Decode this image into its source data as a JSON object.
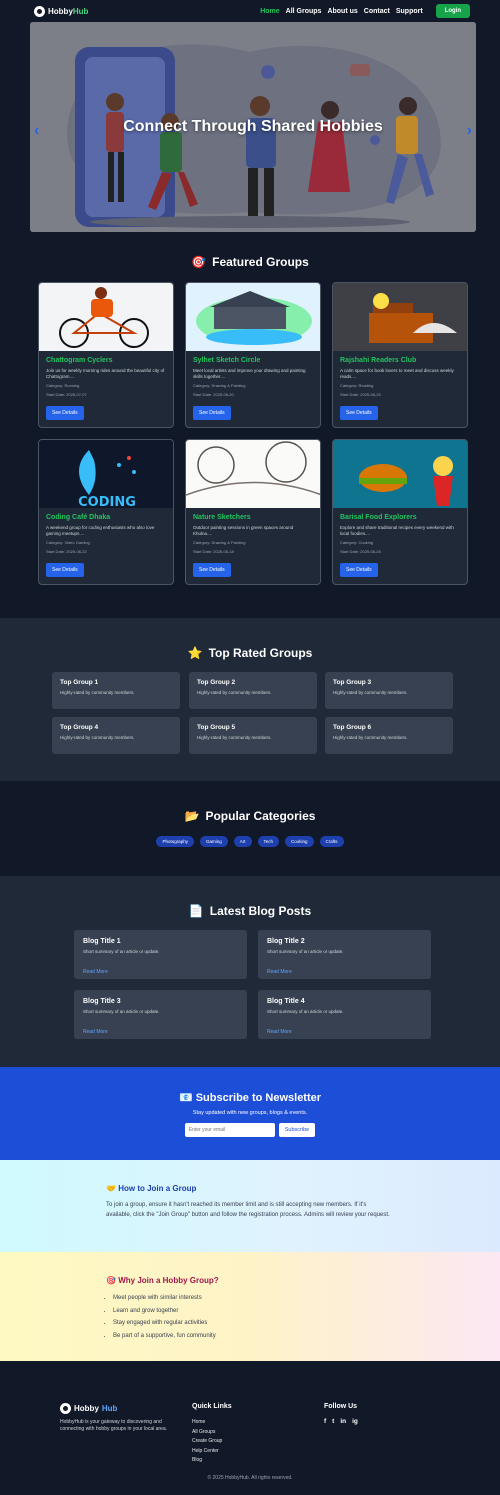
{
  "nav": {
    "brand_a": "Hobby",
    "brand_b": "Hub",
    "links": [
      "Home",
      "All Groups",
      "About us",
      "Contact",
      "Support"
    ],
    "login": "Login"
  },
  "hero": {
    "title": "Connect Through Shared Hobbies",
    "prev": "‹",
    "next": "›"
  },
  "featured": {
    "icon": "🎯",
    "title": "Featured Groups",
    "category_label": "Category:",
    "date_label": "Start Date:",
    "button": "See Details",
    "groups": [
      {
        "name": "Chattogram Cyclers",
        "desc": "Join us for weekly morning rides around the beautiful city of Chattogram....",
        "category": "Running",
        "date": "2025-07-07"
      },
      {
        "name": "Sylhet Sketch Circle",
        "desc": "Meet local artists and improve your drawing and painting skills together....",
        "category": "Drawing & Painting",
        "date": "2025-06-20"
      },
      {
        "name": "Rajshahi Readers Club",
        "desc": "A calm space for book lovers to meet and discuss weekly reads....",
        "category": "Reading",
        "date": "2025-06-25"
      },
      {
        "name": "Coding Café Dhaka",
        "desc": "A weekend group for coding enthusiasts who also love gaming meetups....",
        "category": "Video Gaming",
        "date": "2025-06-22"
      },
      {
        "name": "Nature Sketchers",
        "desc": "Outdoor painting sessions in green spaces around Khulna....",
        "category": "Drawing & Painting",
        "date": "2025-06-18"
      },
      {
        "name": "Barisal Food Explorers",
        "desc": "Explore and share traditional recipes every weekend with local foodies....",
        "category": "Cooking",
        "date": "2025-06-28"
      }
    ]
  },
  "top_rated": {
    "icon": "⭐",
    "title": "Top Rated Groups",
    "items": [
      {
        "name": "Top Group 1",
        "desc": "Highly-rated by community members."
      },
      {
        "name": "Top Group 2",
        "desc": "Highly-rated by community members."
      },
      {
        "name": "Top Group 3",
        "desc": "Highly-rated by community members."
      },
      {
        "name": "Top Group 4",
        "desc": "Highly-rated by community members."
      },
      {
        "name": "Top Group 5",
        "desc": "Highly-rated by community members."
      },
      {
        "name": "Top Group 6",
        "desc": "Highly-rated by community members."
      }
    ]
  },
  "categories": {
    "icon": "📂",
    "title": "Popular Categories",
    "items": [
      "Photography",
      "Gaming",
      "Art",
      "Tech",
      "Cooking",
      "Crafts"
    ]
  },
  "blog": {
    "icon": "📄",
    "title": "Latest Blog Posts",
    "read_more": "Read More",
    "posts": [
      {
        "title": "Blog Title 1",
        "summary": "Short summary of an article or update."
      },
      {
        "title": "Blog Title 2",
        "summary": "Short summary of an article or update."
      },
      {
        "title": "Blog Title 3",
        "summary": "Short summary of an article or update."
      },
      {
        "title": "Blog Title 4",
        "summary": "Short summary of an article or update."
      }
    ]
  },
  "newsletter": {
    "icon": "📧",
    "title": "Subscribe to Newsletter",
    "subtitle": "Stay updated with new groups, blogs & events.",
    "placeholder": "Enter your email",
    "button": "Subscribe"
  },
  "how": {
    "icon": "🤝",
    "title": "How to Join a Group",
    "text": "To join a group, ensure it hasn't reached its member limit and is still accepting new members. If it's available, click the \"Join Group\" button and follow the registration process. Admins will review your request."
  },
  "why": {
    "icon": "🎯",
    "title": "Why Join a Hobby Group?",
    "items": [
      "Meet people with similar interests",
      "Learn and grow together",
      "Stay engaged with regular activities",
      "Be part of a supportive, fun community"
    ]
  },
  "footer": {
    "brand_a": "Hobby",
    "brand_b": "Hub",
    "about": "HobbyHub is your gateway to discovering and connecting with hobby groups in your local area.",
    "quick_title": "Quick Links",
    "links": [
      "Home",
      "All Groups",
      "Create Group",
      "Help Center",
      "Blog"
    ],
    "follow_title": "Follow Us",
    "social": [
      "f",
      "t",
      "in",
      "ig"
    ],
    "copyright": "© 2025 HobbyHub. All rights reserved."
  }
}
